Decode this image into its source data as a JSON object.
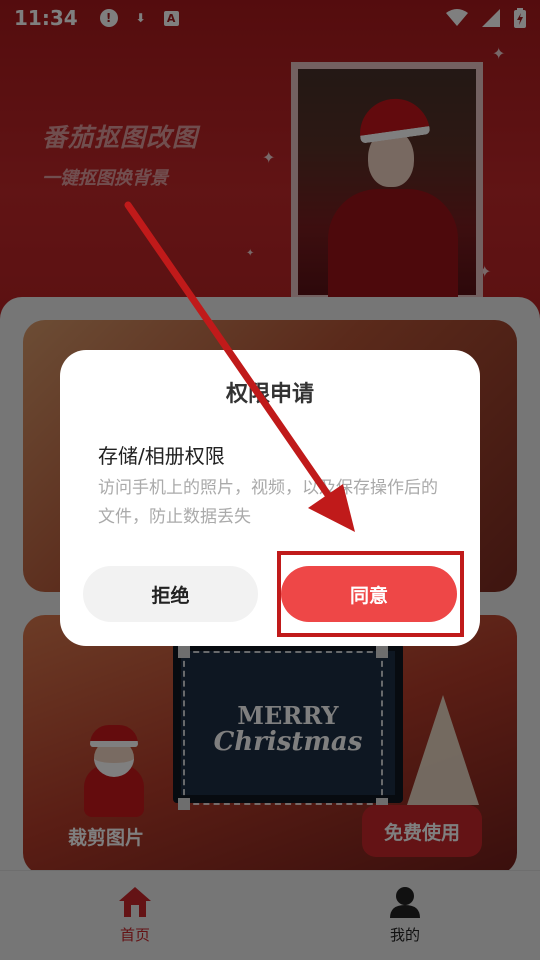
{
  "status_bar": {
    "time": "11:34",
    "icons": [
      "alert-icon",
      "download-icon",
      "a-icon",
      "wifi-icon",
      "signal-icon",
      "battery-icon"
    ],
    "alert_glyph": "!",
    "download_glyph": "⬇",
    "a_glyph": "A"
  },
  "banner": {
    "title": "番茄抠图改图",
    "subtitle": "一键抠图换背景"
  },
  "cards": [
    {
      "label": ""
    },
    {
      "label": "裁剪图片",
      "button": "免费使用",
      "monitor_line1": "MERRY",
      "monitor_line2": "Christmas"
    }
  ],
  "bottom_nav": [
    {
      "label": "首页",
      "icon": "home-icon",
      "active": true
    },
    {
      "label": "我的",
      "icon": "user-icon",
      "active": false
    }
  ],
  "dialog": {
    "title": "权限申请",
    "permission_name": "存储/相册权限",
    "permission_desc": "访问手机上的照片，视频，以及保存操作后的文件，防止数据丢失",
    "deny_label": "拒绝",
    "agree_label": "同意"
  },
  "colors": {
    "brand_red": "#c8262b",
    "agree_red": "#ee4747",
    "annotation_red": "#c01a1a"
  }
}
